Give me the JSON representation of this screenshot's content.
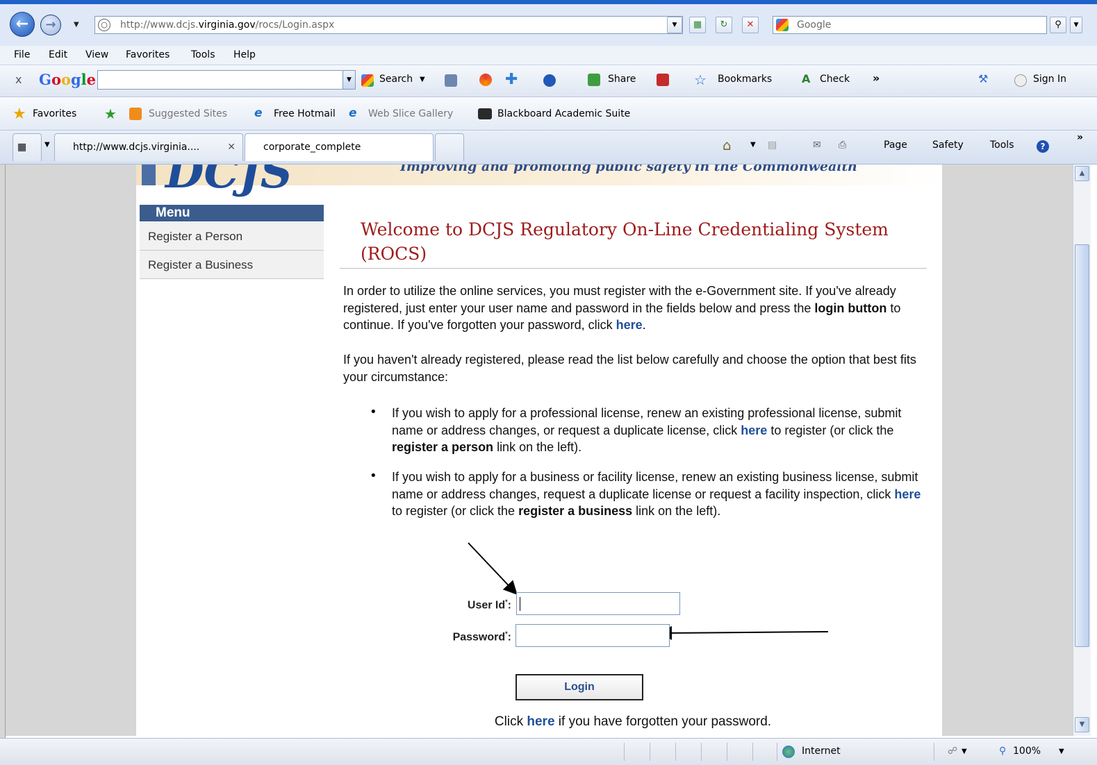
{
  "browser": {
    "url_path": "http://www.dcjs.",
    "url_domain": "virginia.gov",
    "url_rest": "/rocs/Login.aspx",
    "search_placeholder": "Google",
    "menu": [
      "File",
      "Edit",
      "View",
      "Favorites",
      "Tools",
      "Help"
    ],
    "google_toolbar": {
      "close": "x",
      "search_label": "Search",
      "share_label": "Share",
      "bookmarks_label": "Bookmarks",
      "check_label": "Check",
      "more": "»",
      "signin_label": "Sign In"
    },
    "favorites_bar": {
      "favorites_label": "Favorites",
      "items": [
        "Suggested Sites",
        "Free Hotmail",
        "Web Slice Gallery",
        "Blackboard Academic Suite"
      ]
    },
    "tabs": [
      {
        "label": "http://www.dcjs.virginia...."
      },
      {
        "label": "corporate_complete"
      }
    ],
    "command_bar": [
      "Page",
      "Safety",
      "Tools"
    ],
    "status": {
      "zone": "Internet",
      "zoom": "100%"
    }
  },
  "site": {
    "tagline": "Improving and promoting public safety in the Commonwealth",
    "logo": "DCJS"
  },
  "sidebar": {
    "heading": "Menu",
    "items": [
      {
        "label": "Register a Person"
      },
      {
        "label": "Register a Business"
      }
    ]
  },
  "main": {
    "title": "Welcome to DCJS Regulatory On-Line Credentialing System (ROCS)",
    "p1_a": "In order to utilize the online services, you must register with the e-Government site. If you've already registered, just enter your user name and password in the fields below and press the ",
    "p1_b": "login button",
    "p1_c": " to continue. If you've forgotten your password, click ",
    "p1_link": "here",
    "p1_d": ".",
    "p2": "If you haven't already registered, please read the list below carefully and choose the option that best fits your circumstance:",
    "b1_a": "If you wish to apply for a professional license, renew an existing professional license, submit name or address changes, or request a duplicate license, click ",
    "b1_link": "here",
    "b1_b": " to register (or click the ",
    "b1_bold": "register a person",
    "b1_c": " link on the left).",
    "b2_a": "If you wish to apply for a business or facility license, renew an existing business license, submit name or address changes, request a duplicate license or request a facility inspection, click ",
    "b2_link": "here",
    "b2_b": " to register (or click the ",
    "b2_bold": "register a business",
    "b2_c": " link on the left)."
  },
  "form": {
    "userid_label": "User Id",
    "password_label": "Password",
    "required_mark": "*",
    "colon": ":",
    "userid_value": "",
    "password_value": "",
    "login_label": "Login",
    "forgot_a": "Click ",
    "forgot_link": "here",
    "forgot_b": " if you have forgotten your password."
  }
}
